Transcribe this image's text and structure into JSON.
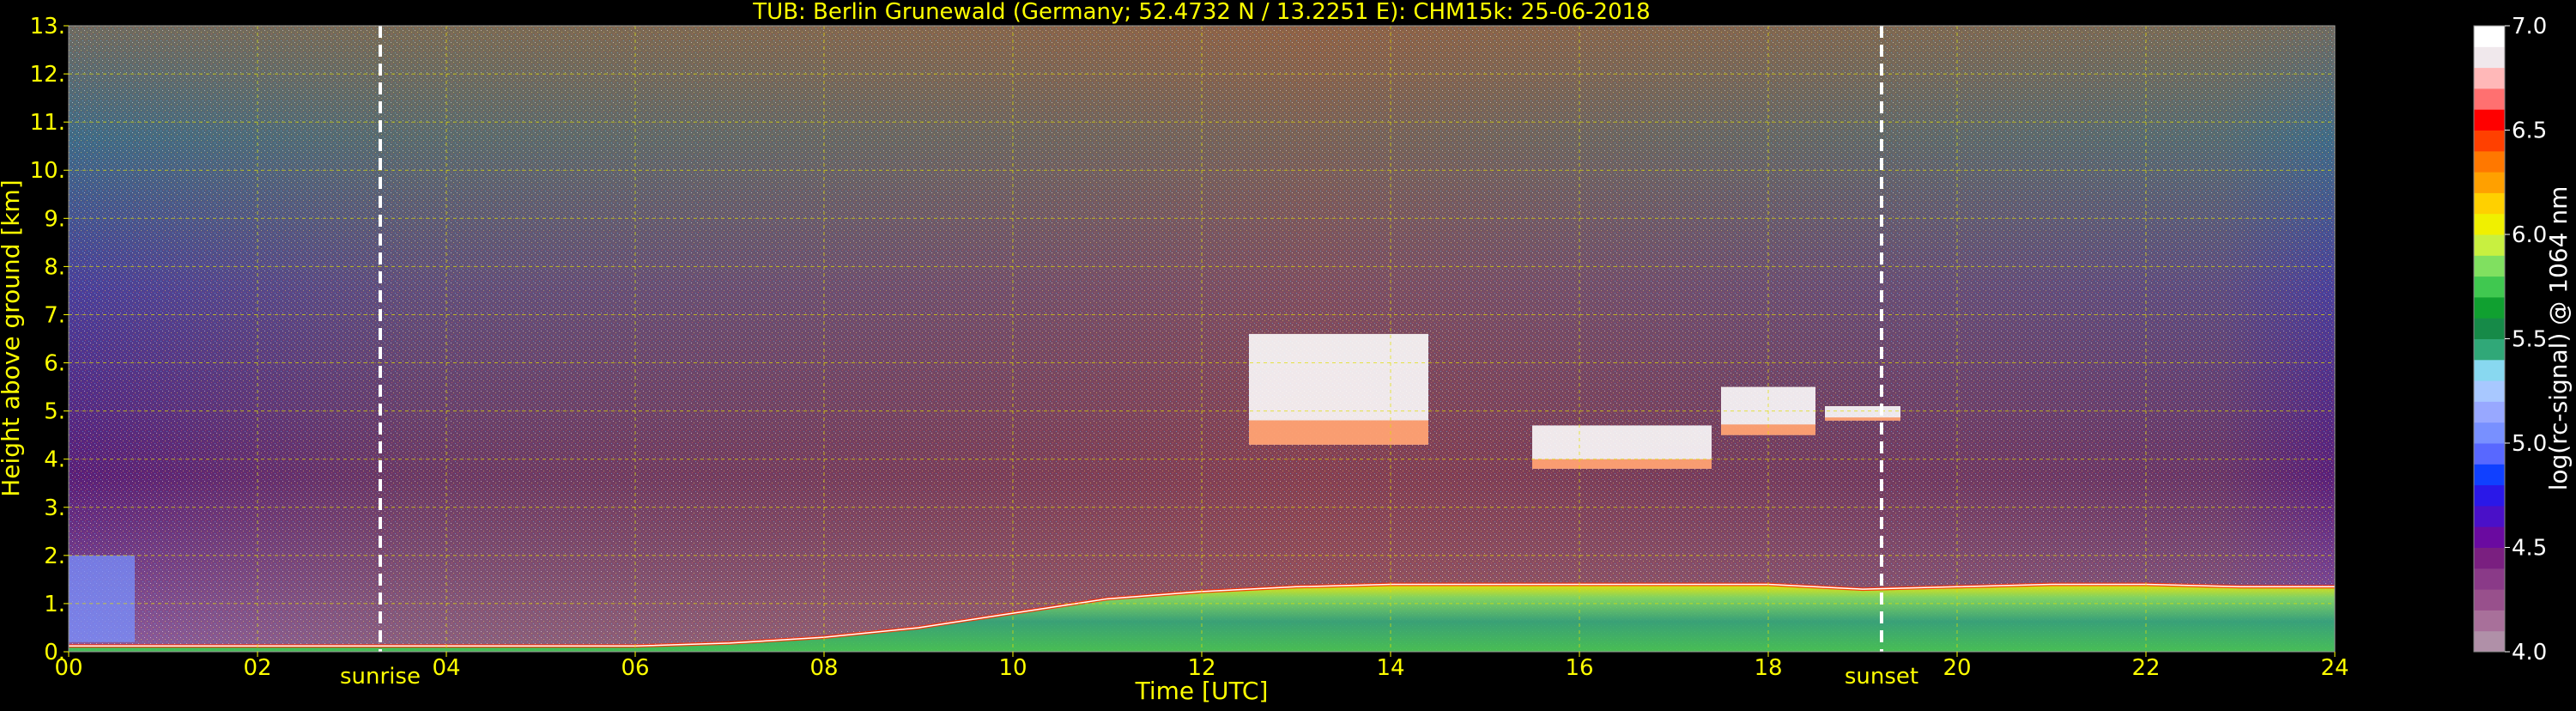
{
  "chart_data": {
    "type": "heatmap",
    "title": "TUB: Berlin Grunewald (Germany; 52.4732 N / 13.2251 E):    CHM15k: 25-06-2018",
    "xlabel": "Time [UTC]",
    "ylabel": "Height above ground [km]",
    "colorbar_label": "log(rc-signal) @ 1064 nm",
    "xlim": [
      0,
      24
    ],
    "ylim": [
      0,
      13
    ],
    "x_ticks": [
      0,
      2,
      4,
      6,
      8,
      10,
      12,
      14,
      16,
      18,
      20,
      22,
      24
    ],
    "x_tick_labels": [
      "00",
      "02",
      "04",
      "06",
      "08",
      "10",
      "12",
      "14",
      "16",
      "18",
      "20",
      "22",
      "24"
    ],
    "y_ticks": [
      0,
      1,
      2,
      3,
      4,
      5,
      6,
      7,
      8,
      9,
      10,
      11,
      12,
      13
    ],
    "y_tick_labels": [
      "0.",
      "1.",
      "2.",
      "3.",
      "4.",
      "5.",
      "6.",
      "7.",
      "8.",
      "9.",
      "10.",
      "11.",
      "12.",
      "13."
    ],
    "grid": true,
    "colorbar": {
      "range": [
        4.0,
        7.0
      ],
      "ticks": [
        4.0,
        4.5,
        5.0,
        5.5,
        6.0,
        6.5,
        7.0
      ],
      "tick_labels": [
        "4.0",
        "4.5",
        "5.0",
        "5.5",
        "6.0",
        "6.5",
        "7.0"
      ],
      "colors": [
        "#b090a8",
        "#a8709a",
        "#98508c",
        "#8a3a88",
        "#7a1f80",
        "#6a0aa0",
        "#4a10c8",
        "#2a18e8",
        "#1040ff",
        "#5868ff",
        "#7890ff",
        "#98a8ff",
        "#a8c8ff",
        "#88d8f0",
        "#30a878",
        "#168a48",
        "#10a030",
        "#40c850",
        "#80e060",
        "#c8f040",
        "#f0f000",
        "#ffd000",
        "#ffa000",
        "#ff7800",
        "#ff4000",
        "#ff0000",
        "#ff7070",
        "#ffb8b8",
        "#f0e8ec",
        "#ffffff"
      ]
    },
    "annotations": [
      {
        "label": "sunrise",
        "x": 3.3
      },
      {
        "label": "sunset",
        "x": 19.2
      }
    ],
    "features": {
      "surface_layer_top": [
        [
          0,
          0.12
        ],
        [
          2,
          0.12
        ],
        [
          4,
          0.12
        ],
        [
          6,
          0.12
        ],
        [
          7,
          0.18
        ],
        [
          8,
          0.3
        ],
        [
          9,
          0.5
        ],
        [
          10,
          0.8
        ],
        [
          11,
          1.1
        ],
        [
          12,
          1.25
        ],
        [
          13,
          1.35
        ],
        [
          14,
          1.4
        ],
        [
          15,
          1.4
        ],
        [
          16,
          1.4
        ],
        [
          17,
          1.4
        ],
        [
          18,
          1.4
        ],
        [
          19,
          1.3
        ],
        [
          20,
          1.35
        ],
        [
          21,
          1.4
        ],
        [
          22,
          1.4
        ],
        [
          23,
          1.35
        ],
        [
          24,
          1.35
        ]
      ],
      "cloud_layers": [
        {
          "x_start": 12.5,
          "x_end": 14.4,
          "y_bottom": 4.3,
          "y_top": 6.6
        },
        {
          "x_start": 15.5,
          "x_end": 17.4,
          "y_bottom": 3.8,
          "y_top": 4.7
        },
        {
          "x_start": 17.5,
          "x_end": 18.5,
          "y_bottom": 4.5,
          "y_top": 5.5
        },
        {
          "x_start": 18.6,
          "x_end": 19.4,
          "y_bottom": 4.8,
          "y_top": 5.1
        }
      ],
      "early_residual_layer": {
        "x_start": 0,
        "x_end": 0.7,
        "y_bottom": 0.2,
        "y_top": 2.0
      }
    }
  }
}
